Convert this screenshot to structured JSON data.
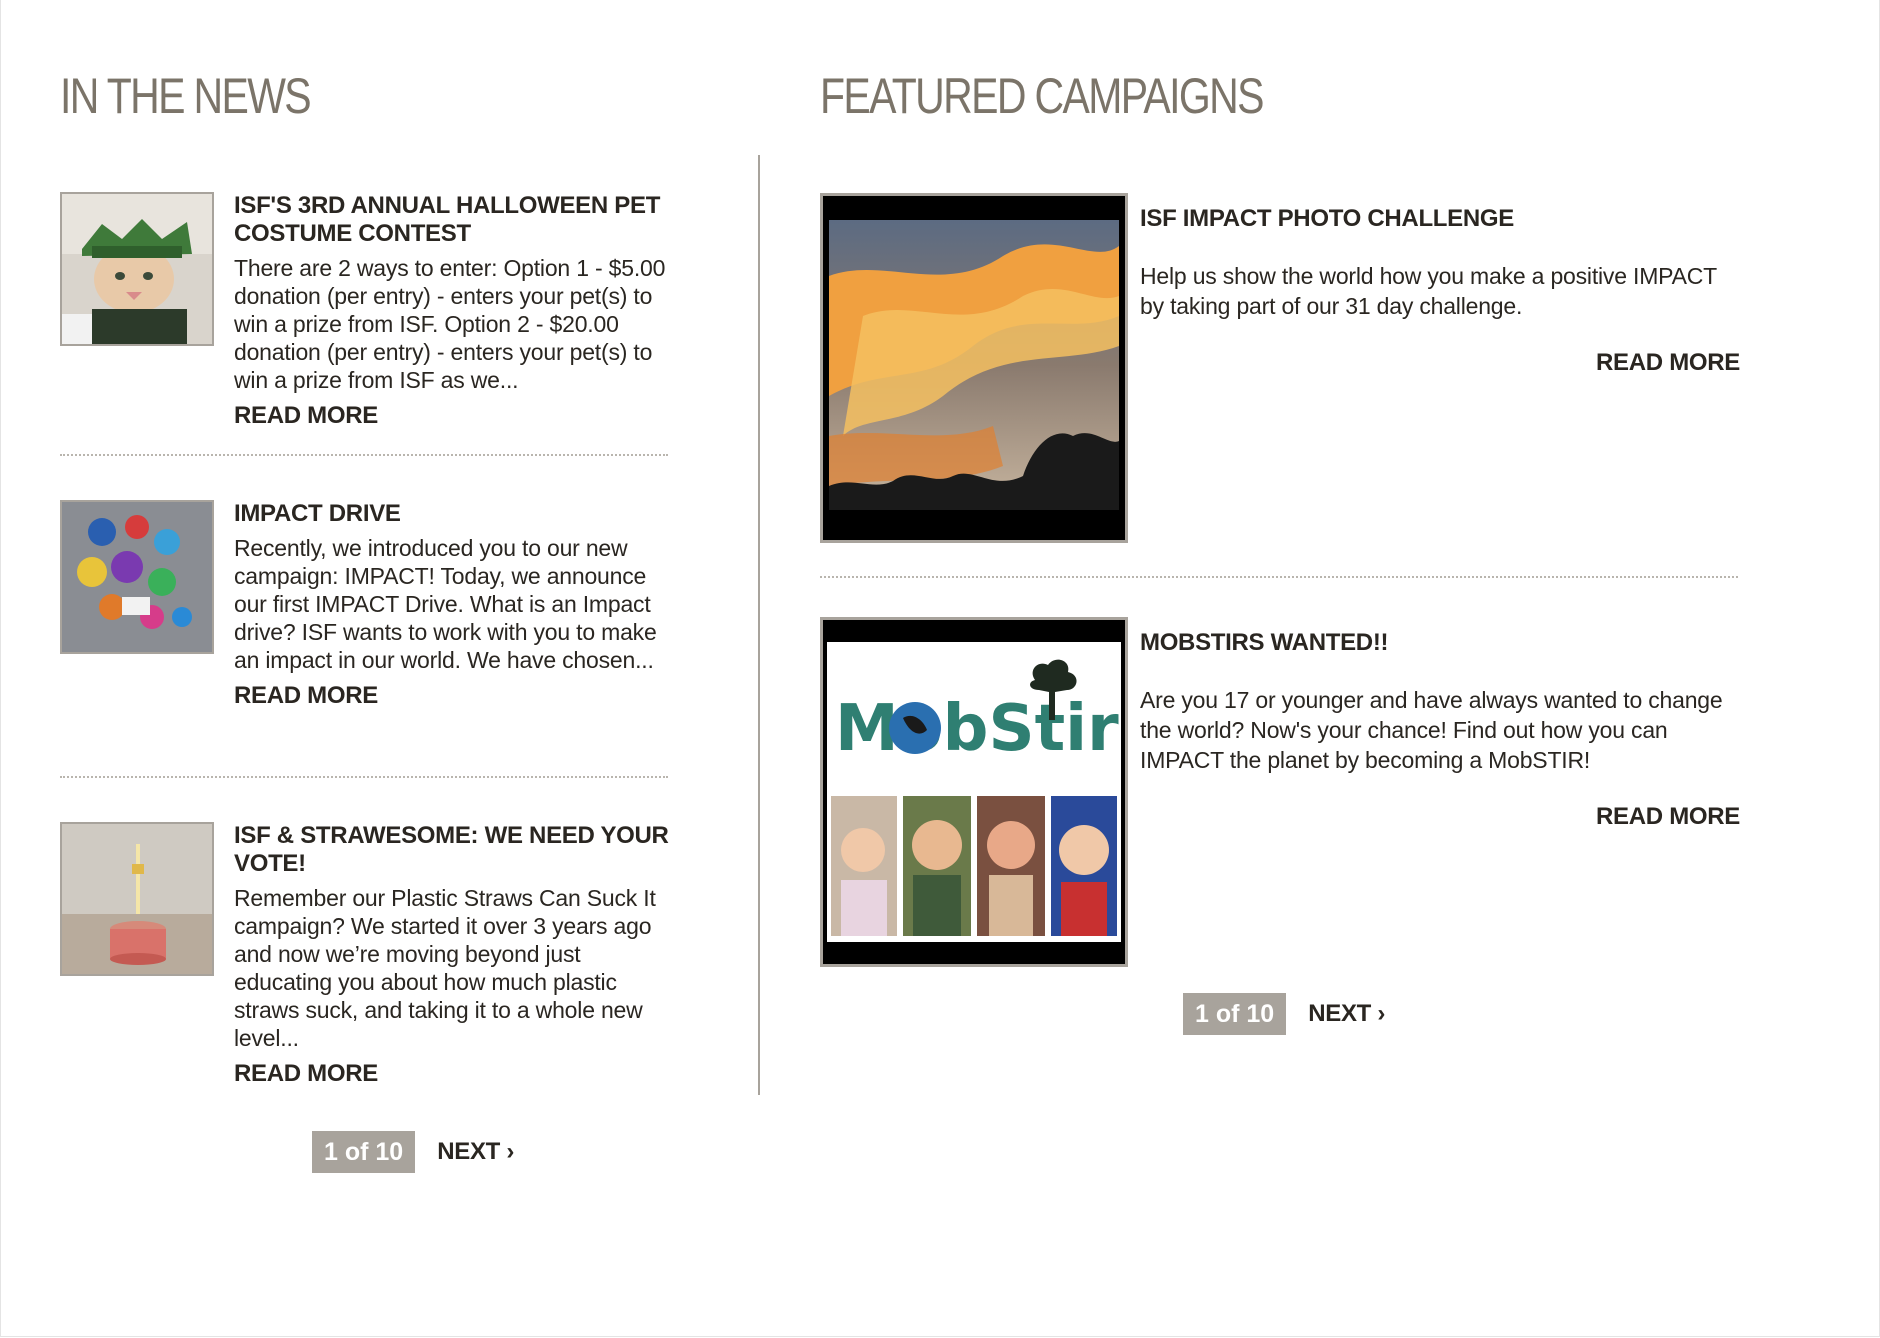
{
  "news": {
    "title": "IN THE NEWS",
    "items": [
      {
        "title": "ISF'S 3RD ANNUAL HALLOWEEN PET COSTUME CONTEST",
        "text": "There are 2 ways to enter: Option 1 - $5.00 donation (per entry) - enters your pet(s) to win a prize from ISF. Option 2 - $20.00 donation (per entry) - enters your pet(s) to win a prize from ISF as we...",
        "read_more": "READ MORE"
      },
      {
        "title": "IMPACT DRIVE",
        "text": "Recently, we introduced you to our new campaign: IMPACT! Today, we announce our first IMPACT Drive. What is an Impact drive? ISF wants to work with you to make an impact in our world. We have chosen...",
        "read_more": "READ MORE"
      },
      {
        "title": "ISF & STRAWESOME: WE NEED YOUR VOTE!",
        "text": "  Remember our Plastic Straws Can Suck It campaign? We started it over 3 years ago and now we’re moving beyond just educating you about how much plastic straws suck, and taking it to a whole new level...",
        "read_more": "READ MORE"
      }
    ],
    "pager": {
      "current": "1 of 10",
      "next": "NEXT ›"
    }
  },
  "campaigns": {
    "title": "FEATURED CAMPAIGNS",
    "items": [
      {
        "title": "ISF IMPACT PHOTO CHALLENGE",
        "text": "Help us show the world how you make a positive IMPACT by taking part of our 31 day challenge.",
        "read_more": "READ MORE"
      },
      {
        "title": "MOBSTIRS WANTED!!",
        "text": "Are you 17 or younger and have always wanted to change the world? Now's your chance! Find out how you can IMPACT the planet by becoming a MobSTIR!",
        "read_more": "READ MORE",
        "logo_text": "MobStir"
      }
    ],
    "pager": {
      "current": "1 of 10",
      "next": "NEXT ›"
    }
  },
  "colors": {
    "accent": "#a8a39c",
    "heading": "#7b7469",
    "text": "#2a2621"
  }
}
